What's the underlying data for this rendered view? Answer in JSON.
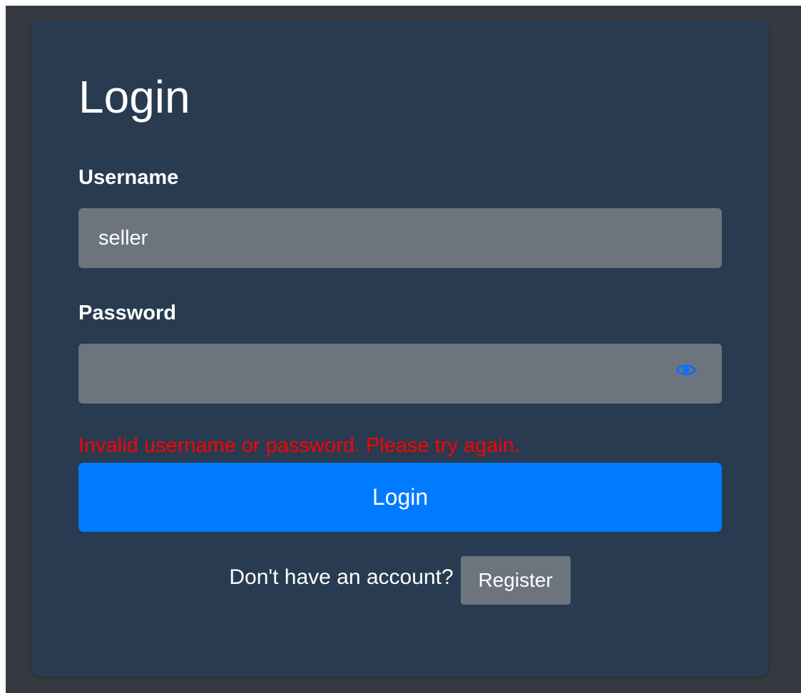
{
  "login": {
    "title": "Login",
    "username_label": "Username",
    "username_value": "seller",
    "password_label": "Password",
    "password_value": "",
    "error_message": "Invalid username or password. Please try again.",
    "login_button": "Login",
    "register_prompt": "Don't have an account?",
    "register_button": "Register"
  },
  "icons": {
    "password_toggle": "eye-icon"
  },
  "colors": {
    "background": "#343a40",
    "card": "#283b50",
    "input": "#6c757d",
    "primary": "#007bff",
    "error": "#ff0000"
  }
}
